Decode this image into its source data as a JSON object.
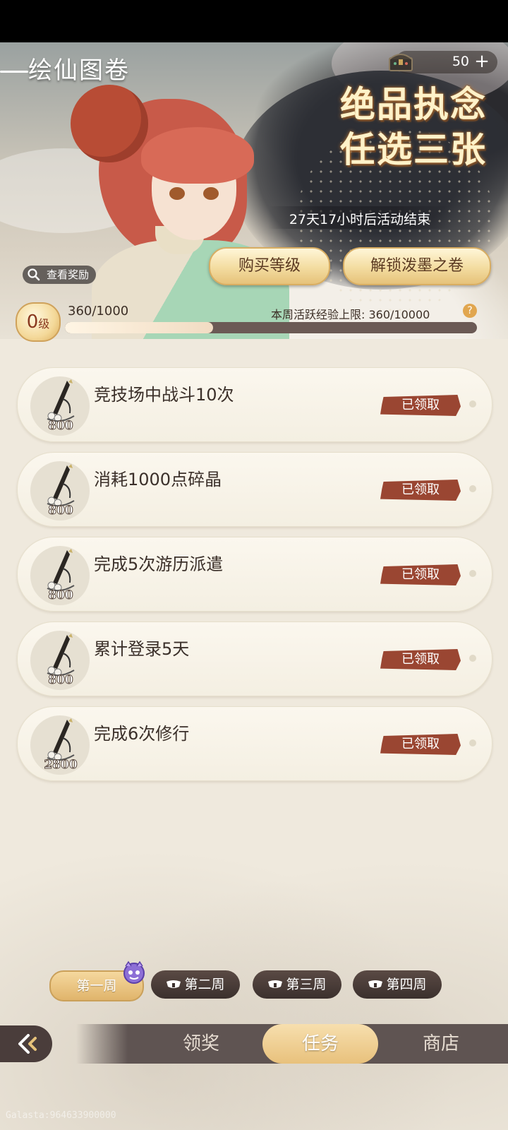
{
  "header": {
    "title": "绘仙图卷",
    "currency_value": "50",
    "promo_line1": "绝品执念",
    "promo_line2": "任选三张",
    "countdown": "27天17小时后活动结束",
    "buy_level_label": "购买等级",
    "unlock_label": "解锁泼墨之卷",
    "view_reward_label": "查看奖励"
  },
  "progress": {
    "level_value": "0",
    "level_unit": "级",
    "exp_text": "360/1000",
    "exp_fraction": 0.36,
    "weekly_limit_text": "本周活跃经验上限: 360/10000"
  },
  "tasks": [
    {
      "name": "竞技场中战斗10次",
      "reward": "800",
      "status": "已领取"
    },
    {
      "name": "消耗1000点碎晶",
      "reward": "800",
      "status": "已领取"
    },
    {
      "name": "完成5次游历派遣",
      "reward": "800",
      "status": "已领取"
    },
    {
      "name": "累计登录5天",
      "reward": "800",
      "status": "已领取"
    },
    {
      "name": "完成6次修行",
      "reward": "2800",
      "status": "已领取"
    }
  ],
  "weeks": [
    "第一周",
    "第二周",
    "第三周",
    "第四周"
  ],
  "nav": {
    "claim": "领奖",
    "task": "任务",
    "shop": "商店"
  },
  "watermark": "Galasta:964633900000",
  "colors": {
    "accent_gold": "#e6c27a",
    "claimed_red": "#9a4632",
    "card_bg": "#f4efe2"
  },
  "icons": {
    "chest": "treasure-chest-icon",
    "plus": "plus-icon",
    "search": "magnifier-icon",
    "brush": "ink-brush-icon",
    "lock": "lock-icon",
    "back": "back-arrow-icon",
    "help": "question-icon"
  }
}
